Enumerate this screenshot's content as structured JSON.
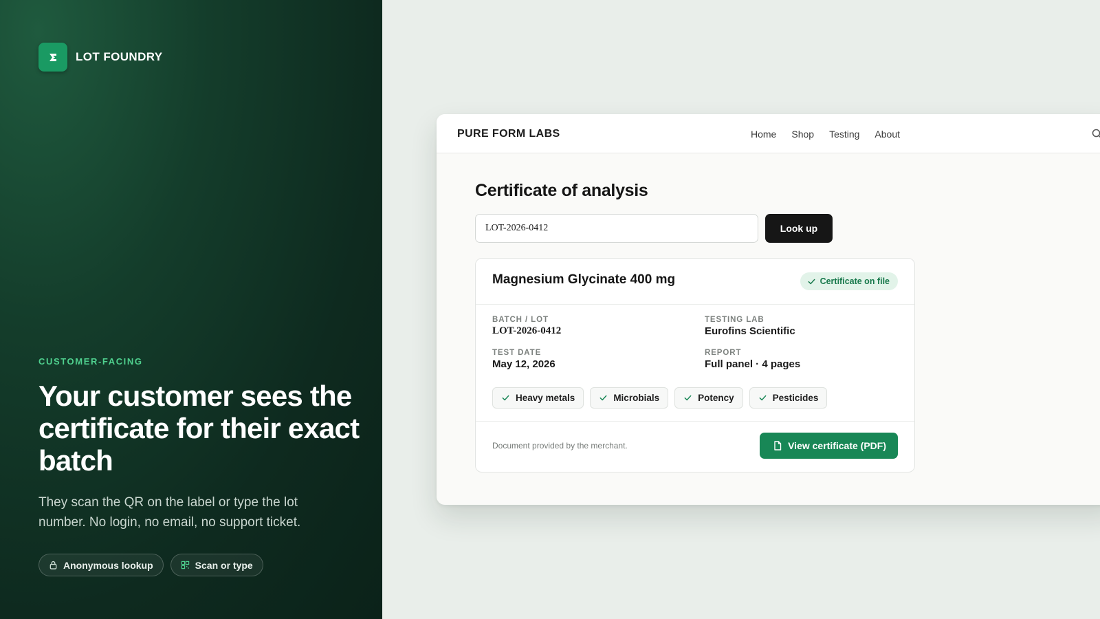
{
  "hero": {
    "brand_name": "LOT FOUNDRY",
    "brand_color": "#1a9a63",
    "eyebrow": "CUSTOMER-FACING",
    "headline": "Your customer sees the certificate for their exact batch",
    "lede": "They scan the QR on the label or type the lot number. No login, no email, no support ticket.",
    "chips": [
      {
        "icon": "lock-icon",
        "label": "Anonymous lookup"
      },
      {
        "icon": "qr-code-icon",
        "label": "Scan or type"
      }
    ]
  },
  "site": {
    "logo": "PURE FORM LABS",
    "nav": [
      "Home",
      "Shop",
      "Testing",
      "About"
    ],
    "search_icon": "search-icon"
  },
  "coa": {
    "title": "Certificate of analysis",
    "lot_input_value": "LOT-2026-0412",
    "lookup_label": "Look up",
    "product_name": "Magnesium Glycinate 400 mg",
    "badge": "Certificate on file",
    "fields": {
      "batch_label": "BATCH / LOT",
      "batch_value": "LOT-2026-0412",
      "lab_label": "TESTING LAB",
      "lab_value": "Eurofins Scientific",
      "date_label": "TEST DATE",
      "date_value": "May 12, 2026",
      "report_label": "REPORT",
      "report_value": "Full panel · 4 pages"
    },
    "tests": [
      "Heavy metals",
      "Microbials",
      "Potency",
      "Pesticides"
    ],
    "footer_note": "Document provided by the merchant.",
    "pdf_label": "View certificate (PDF)",
    "accent_color": "#188756"
  }
}
